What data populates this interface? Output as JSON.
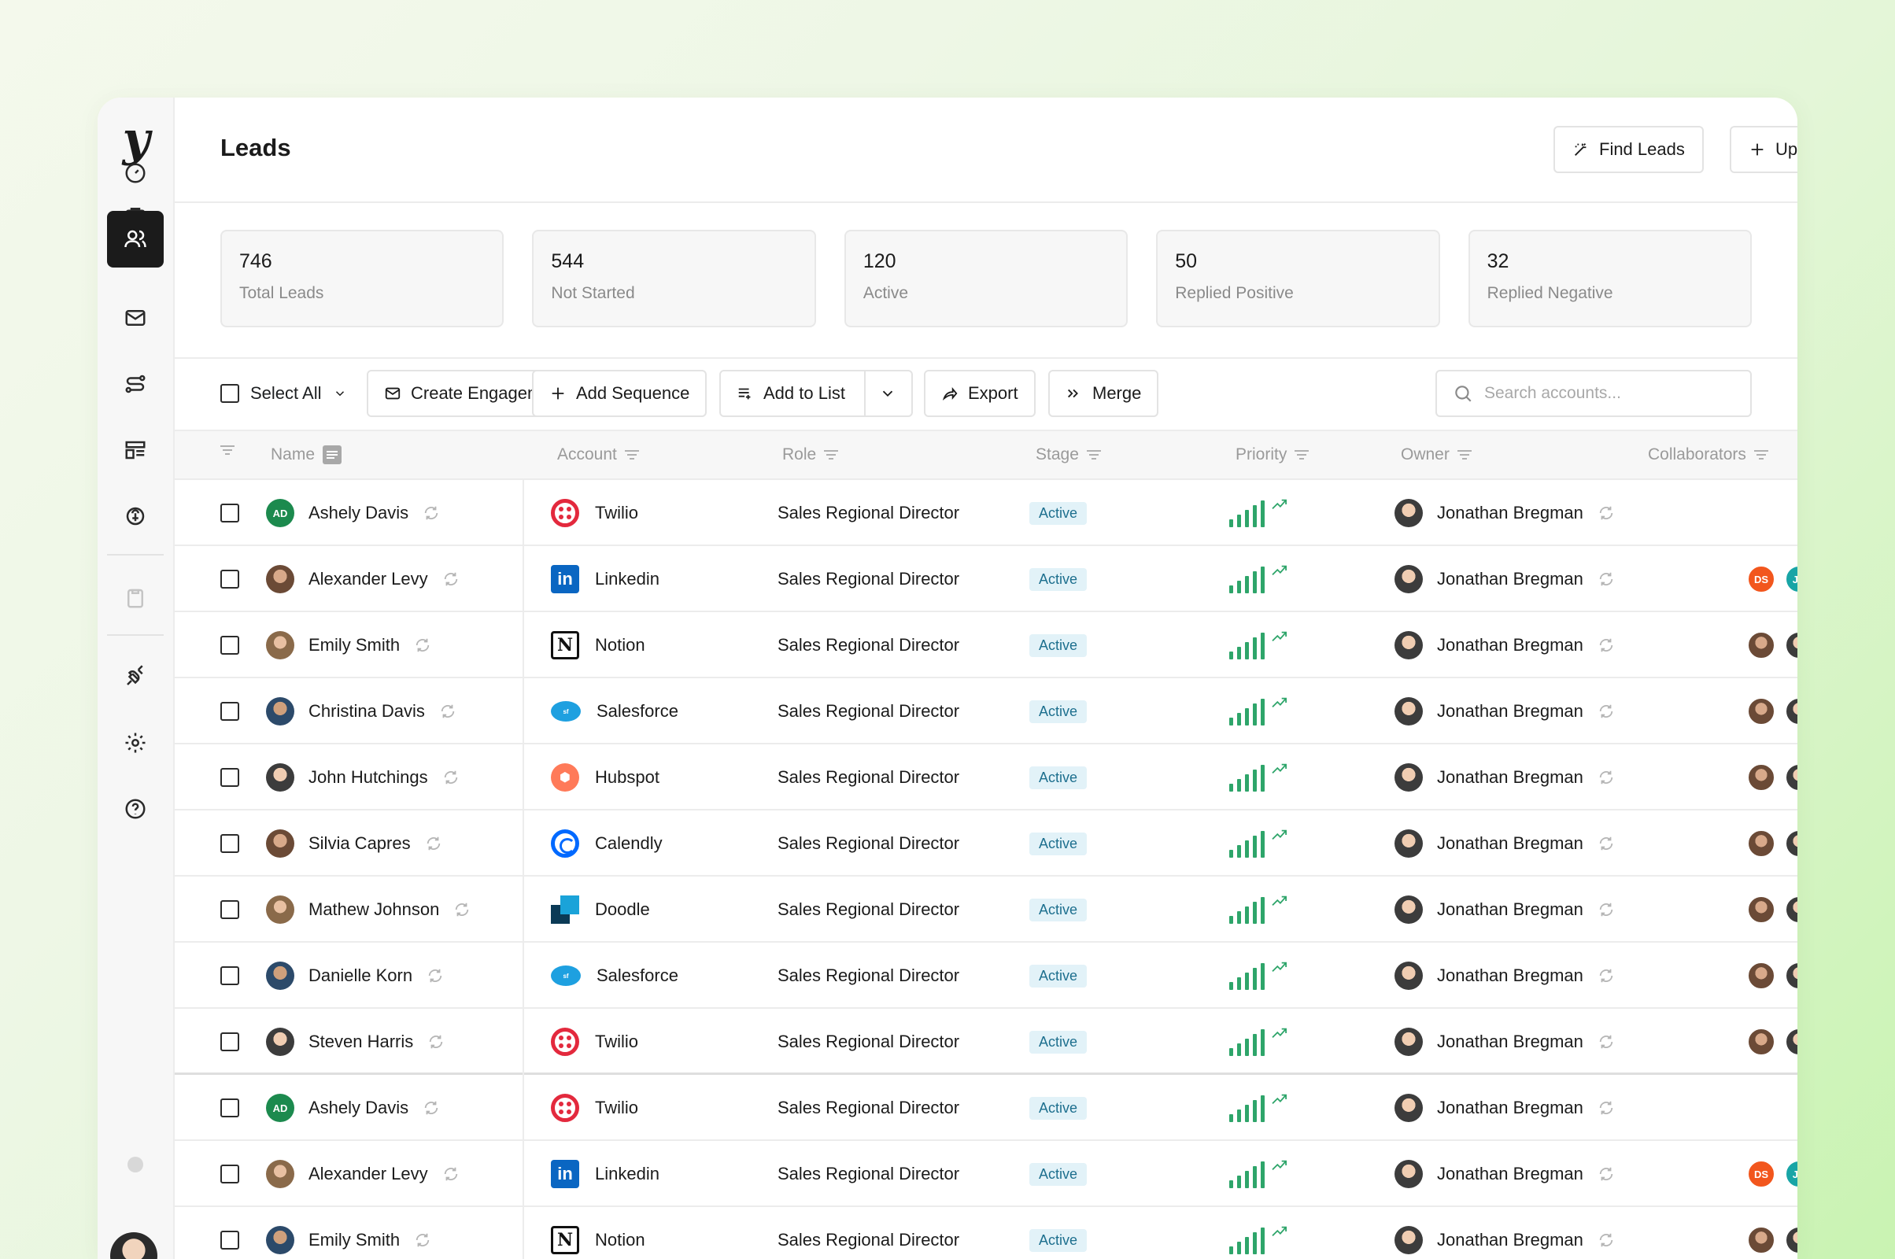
{
  "app": {
    "logo": "y",
    "page_title": "Leads",
    "find_leads_label": "Find Leads",
    "upload_label": "Upload"
  },
  "sidebar": {
    "items": [
      {
        "icon": "dashboard-icon"
      },
      {
        "icon": "briefcase-icon"
      },
      {
        "icon": "users-icon",
        "active": true
      },
      {
        "icon": "mail-icon"
      },
      {
        "icon": "route-icon"
      },
      {
        "icon": "layout-icon"
      },
      {
        "icon": "brain-icon"
      },
      {
        "icon": "clipboard-icon"
      },
      {
        "icon": "plug-icon"
      },
      {
        "icon": "gear-icon"
      },
      {
        "icon": "help-icon"
      }
    ]
  },
  "stats": [
    {
      "value": "746",
      "label": "Total Leads"
    },
    {
      "value": "544",
      "label": "Not Started"
    },
    {
      "value": "120",
      "label": "Active"
    },
    {
      "value": "50",
      "label": "Replied Positive"
    },
    {
      "value": "32",
      "label": "Replied Negative"
    }
  ],
  "toolbar": {
    "select_all": "Select All",
    "create_engagement": "Create Engagement",
    "add_sequence": "Add Sequence",
    "add_to_list": "Add to List",
    "export": "Export",
    "merge": "Merge",
    "search_placeholder": "Search accounts..."
  },
  "table": {
    "columns": [
      "Name",
      "Account",
      "Role",
      "Stage",
      "Priority",
      "Owner",
      "Collaborators"
    ],
    "rows": [
      {
        "name": "Ashely Davis",
        "initials": "AD",
        "account": "Twilio",
        "logo": "twilio",
        "role": "Sales Regional Director",
        "stage": "Active",
        "owner": "Jonathan Bregman",
        "collab": "none"
      },
      {
        "name": "Alexander Levy",
        "account": "Linkedin",
        "logo": "linkedin",
        "role": "Sales Regional Director",
        "stage": "Active",
        "owner": "Jonathan Bregman",
        "collab": "initials"
      },
      {
        "name": "Emily Smith",
        "account": "Notion",
        "logo": "notion",
        "role": "Sales Regional Director",
        "stage": "Active",
        "owner": "Jonathan Bregman",
        "collab": "photos"
      },
      {
        "name": "Christina Davis",
        "account": "Salesforce",
        "logo": "salesforce",
        "role": "Sales Regional Director",
        "stage": "Active",
        "owner": "Jonathan Bregman",
        "collab": "photos"
      },
      {
        "name": "John Hutchings",
        "account": "Hubspot",
        "logo": "hubspot",
        "role": "Sales Regional Director",
        "stage": "Active",
        "owner": "Jonathan Bregman",
        "collab": "photos"
      },
      {
        "name": "Silvia Capres",
        "account": "Calendly",
        "logo": "calendly",
        "role": "Sales Regional Director",
        "stage": "Active",
        "owner": "Jonathan Bregman",
        "collab": "photos"
      },
      {
        "name": "Mathew Johnson",
        "account": "Doodle",
        "logo": "doodle",
        "role": "Sales Regional Director",
        "stage": "Active",
        "owner": "Jonathan Bregman",
        "collab": "photos"
      },
      {
        "name": "Danielle Korn",
        "account": "Salesforce",
        "logo": "salesforce",
        "role": "Sales Regional Director",
        "stage": "Active",
        "owner": "Jonathan Bregman",
        "collab": "photos"
      },
      {
        "name": "Steven Harris",
        "account": "Twilio",
        "logo": "twilio",
        "role": "Sales Regional Director",
        "stage": "Active",
        "owner": "Jonathan Bregman",
        "collab": "photos"
      },
      {
        "name": "Ashely Davis",
        "initials": "AD",
        "account": "Twilio",
        "logo": "twilio",
        "role": "Sales Regional Director",
        "stage": "Active",
        "owner": "Jonathan Bregman",
        "collab": "none"
      },
      {
        "name": "Alexander Levy",
        "account": "Linkedin",
        "logo": "linkedin",
        "role": "Sales Regional Director",
        "stage": "Active",
        "owner": "Jonathan Bregman",
        "collab": "initials"
      },
      {
        "name": "Emily Smith",
        "account": "Notion",
        "logo": "notion",
        "role": "Sales Regional Director",
        "stage": "Active",
        "owner": "Jonathan Bregman",
        "collab": "photos"
      }
    ],
    "collab_initials": [
      "DS",
      "JB"
    ]
  },
  "colors": {
    "accent_dark": "#1b1b1b",
    "stage_badge_bg": "#e2f2f8",
    "priority_green": "#2ea56a",
    "initials_green": "#1c8a4e",
    "collab_ds": "#f2561d",
    "collab_jb": "#18a5a6"
  }
}
